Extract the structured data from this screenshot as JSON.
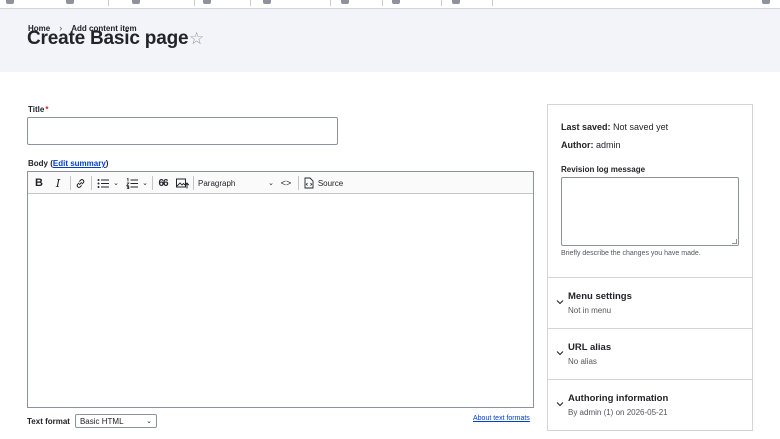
{
  "breadcrumb": {
    "home": "Home",
    "separator": "›",
    "current": "Add content item"
  },
  "page": {
    "title": "Create Basic page",
    "favorite_icon": "☆"
  },
  "form": {
    "title_label": "Title",
    "required_mark": "*",
    "title_value": "",
    "body_label_prefix": "Body (",
    "body_label_link": "Edit summary",
    "body_label_suffix": ")"
  },
  "editor_toolbar": {
    "bold": "B",
    "italic": "I",
    "link_icon": "link-icon",
    "bullet_list_icon": "bulleted-list-icon",
    "numbered_list_icon": "numbered-list-icon",
    "blockquote": "66",
    "image_icon": "insert-image-icon",
    "heading_select": "Paragraph",
    "code": "<>",
    "source": "Source"
  },
  "text_format": {
    "label": "Text format",
    "selected": "Basic HTML",
    "about_link": "About text formats"
  },
  "sidebar": {
    "last_saved_label": "Last saved:",
    "last_saved_value": "Not saved yet",
    "author_label": "Author:",
    "author_value": "admin",
    "revision_label": "Revision log message",
    "revision_help": "Briefly describe the changes you have made.",
    "sections": [
      {
        "title": "Menu settings",
        "summary": "Not in menu"
      },
      {
        "title": "URL alias",
        "summary": "No alias"
      },
      {
        "title": "Authoring information",
        "summary": "By admin (1) on 2026-05-21"
      }
    ]
  },
  "colors": {
    "accent": "#003ecc",
    "required": "#dc2323",
    "header_bg": "#f3f4f9"
  }
}
